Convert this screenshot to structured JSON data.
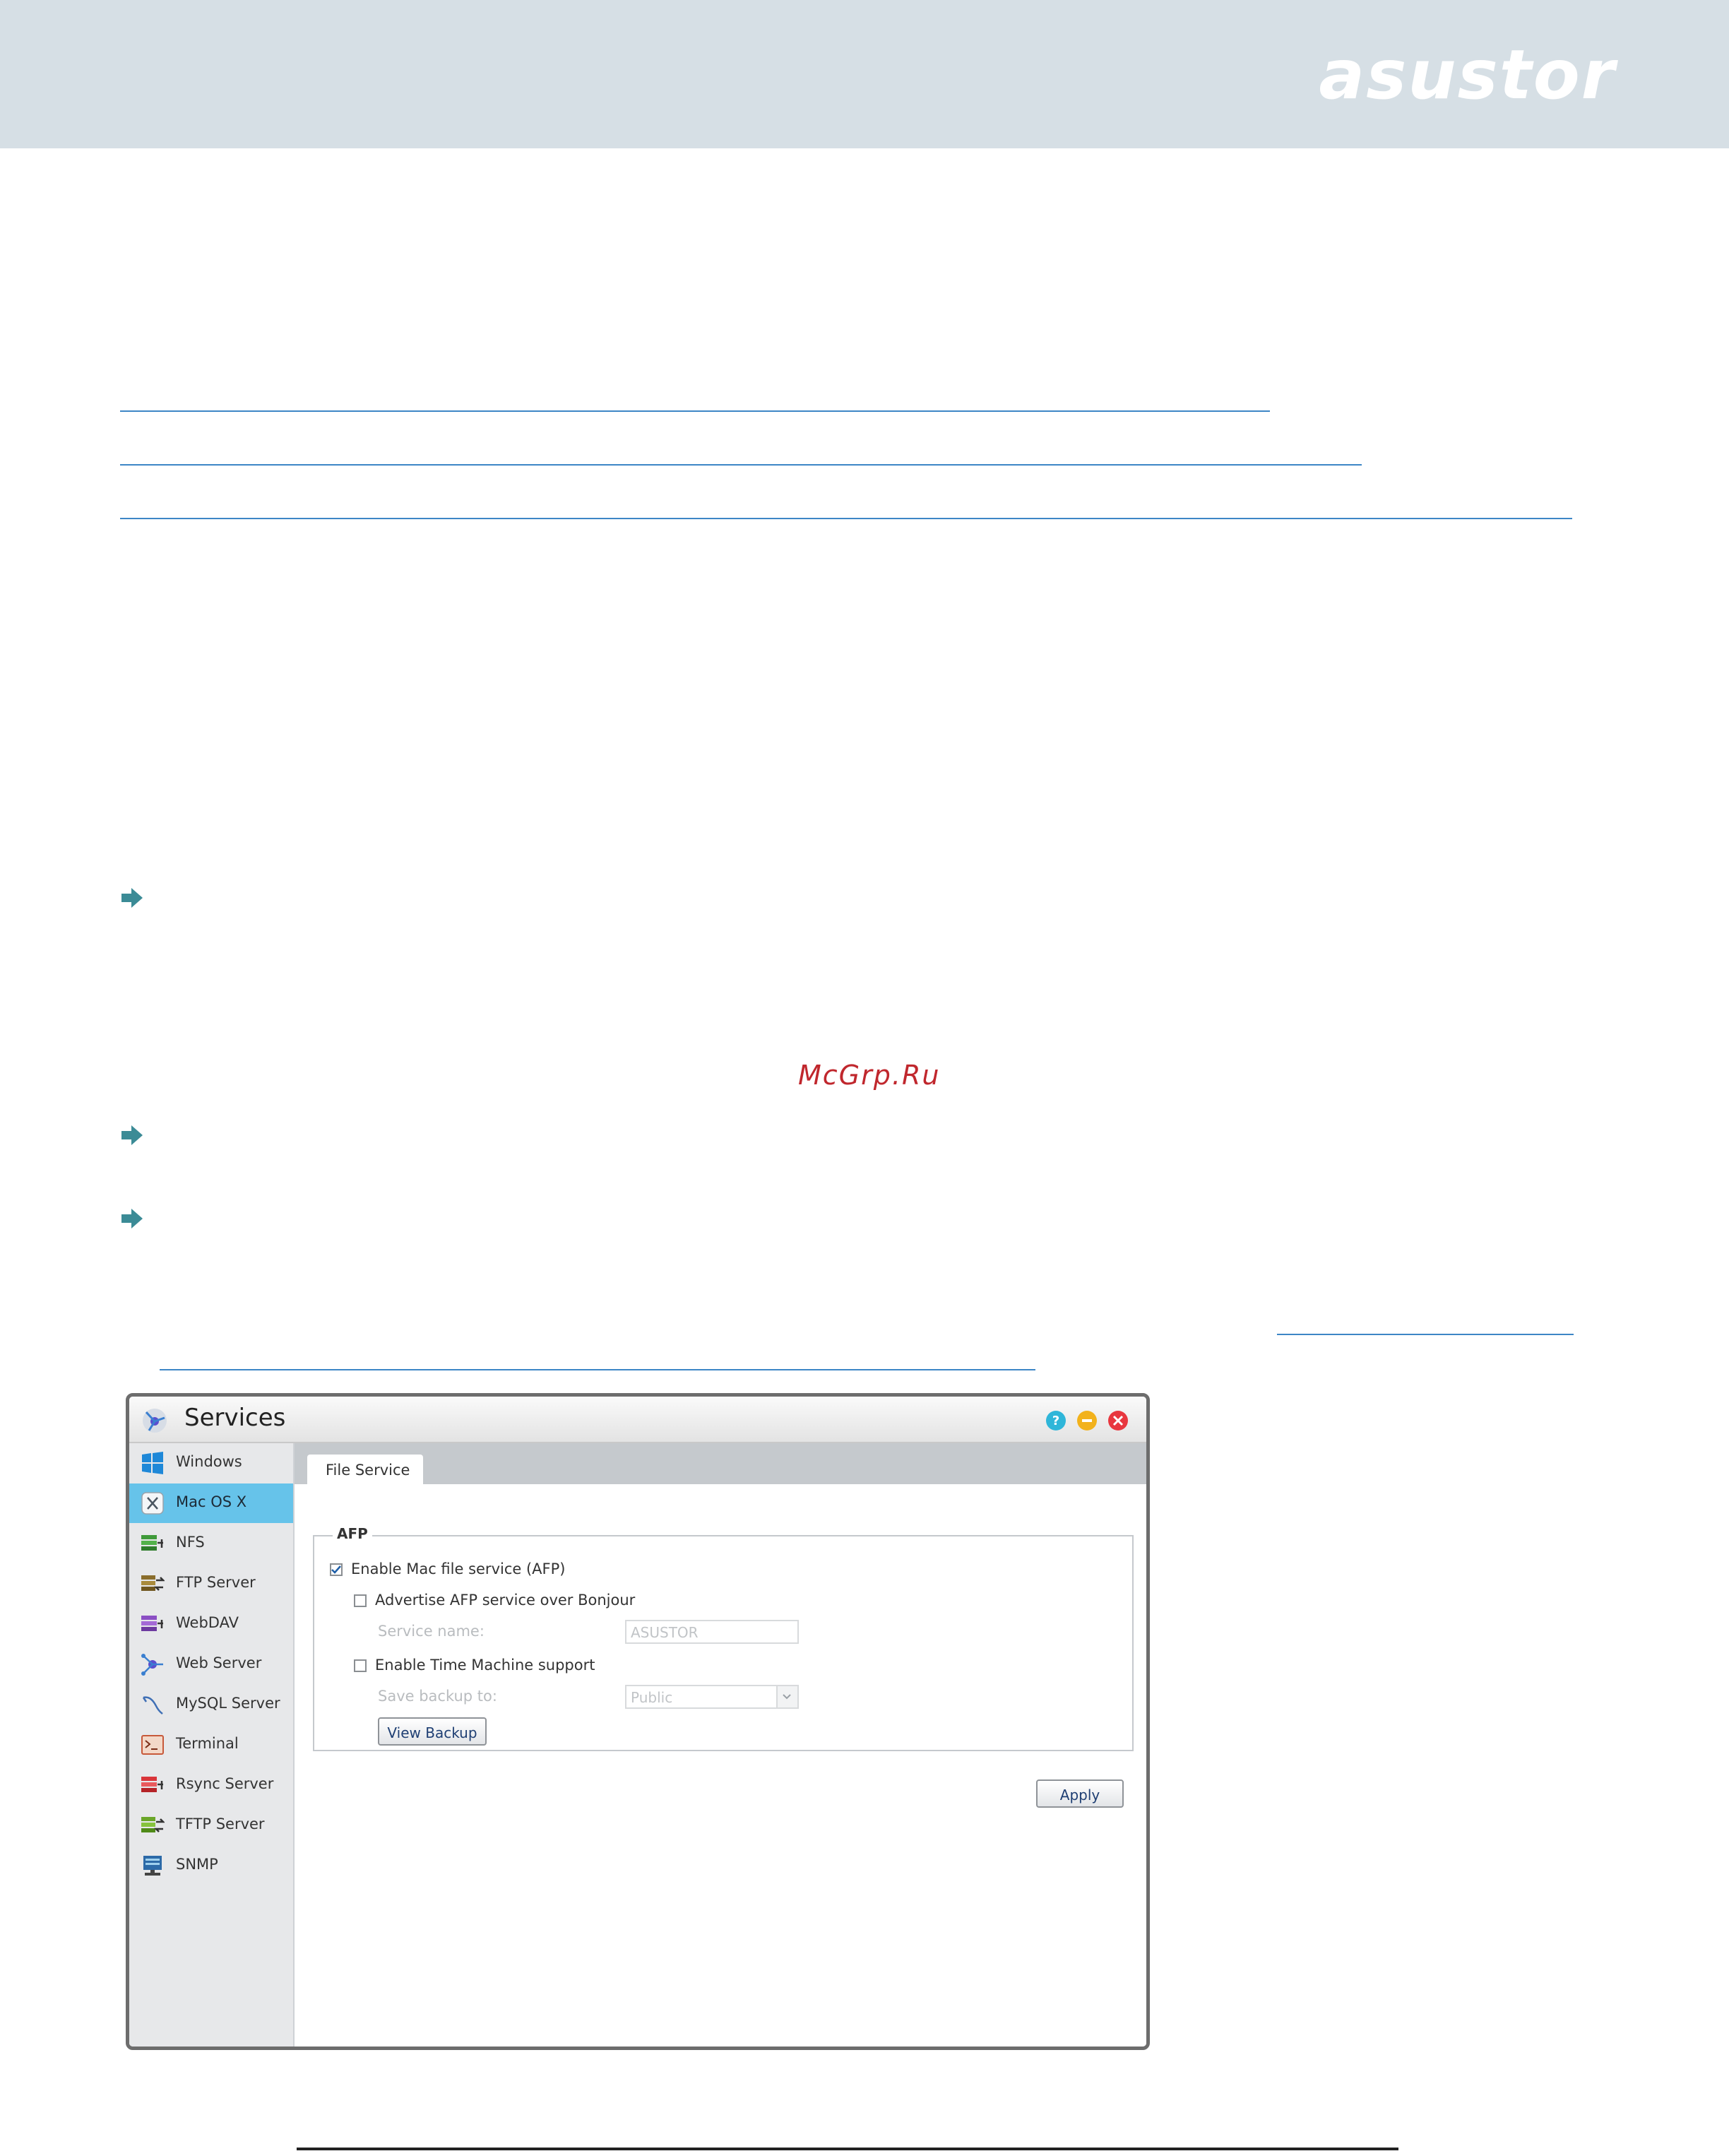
{
  "brand": {
    "logo_text": "asustor",
    "header_color": "#d6dfe5"
  },
  "watermark": "McGrp.Ru",
  "window": {
    "title": "Services",
    "controls": [
      "help-icon",
      "minimize-icon",
      "close-icon"
    ],
    "sidebar": {
      "items": [
        {
          "label": "Windows",
          "icon": "windows-icon",
          "active": false
        },
        {
          "label": "Mac OS X",
          "icon": "mac-os-x-icon",
          "active": true
        },
        {
          "label": "NFS",
          "icon": "nfs-icon",
          "active": false
        },
        {
          "label": "FTP Server",
          "icon": "ftp-server-icon",
          "active": false
        },
        {
          "label": "WebDAV",
          "icon": "webdav-icon",
          "active": false
        },
        {
          "label": "Web Server",
          "icon": "web-server-icon",
          "active": false
        },
        {
          "label": "MySQL Server",
          "icon": "mysql-server-icon",
          "active": false
        },
        {
          "label": "Terminal",
          "icon": "terminal-icon",
          "active": false
        },
        {
          "label": "Rsync Server",
          "icon": "rsync-server-icon",
          "active": false
        },
        {
          "label": "TFTP Server",
          "icon": "tftp-server-icon",
          "active": false
        },
        {
          "label": "SNMP",
          "icon": "snmp-icon",
          "active": false
        }
      ]
    },
    "tabs": [
      {
        "label": "File Service",
        "active": true
      }
    ],
    "afp": {
      "legend": "AFP",
      "enable_afp": {
        "label": "Enable Mac file service (AFP)",
        "checked": true
      },
      "advertise_bonjour": {
        "label": "Advertise AFP service over Bonjour",
        "checked": false
      },
      "service_name": {
        "label": "Service name:",
        "value": "ASUSTOR"
      },
      "time_machine": {
        "label": "Enable Time Machine support",
        "checked": false
      },
      "save_backup": {
        "label": "Save backup to:",
        "value": "Public"
      },
      "view_backup_button": "View Backup"
    },
    "apply_button": "Apply"
  }
}
